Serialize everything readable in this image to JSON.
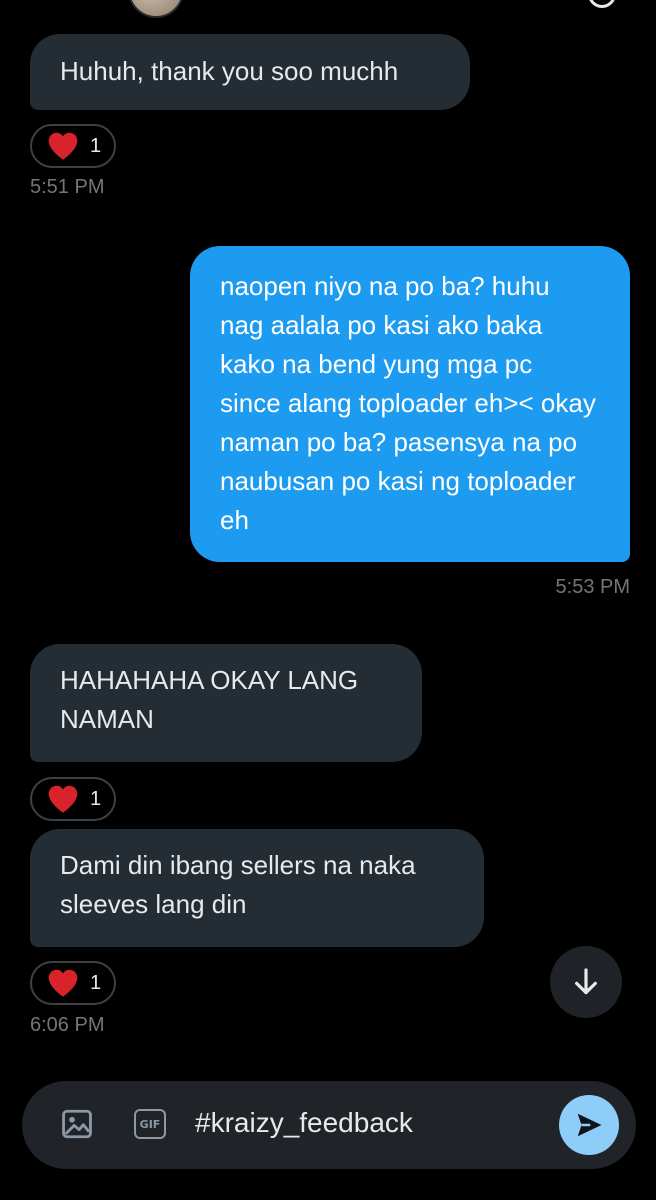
{
  "conversation": {
    "messages": [
      {
        "direction": "received",
        "text": "Huhuh, thank you soo muchh"
      },
      {
        "direction": "sent",
        "text": "naopen niyo na po ba? huhu nag aalala po kasi ako baka kako na bend yung mga pc since alang toploader eh>< okay naman po ba? pasensya na po naubusan po kasi ng toploader eh"
      },
      {
        "direction": "received",
        "text": "HAHAHAHA OKAY LANG NAMAN"
      },
      {
        "direction": "received",
        "text": "Dami din ibang sellers na naka sleeves lang din"
      }
    ],
    "reactions": [
      {
        "emoji": "heart",
        "count": "1"
      },
      {
        "emoji": "heart",
        "count": "1"
      },
      {
        "emoji": "heart",
        "count": "1"
      }
    ],
    "timestamps": [
      "5:51 PM",
      "5:53 PM",
      "6:06 PM"
    ]
  },
  "composer": {
    "value": "#kraizy_feedback",
    "gif_label": "GIF",
    "image_icon": "image-icon",
    "send_icon": "send-icon"
  },
  "scroll_button": {
    "icon": "arrow-down-icon"
  },
  "colors": {
    "background": "#000000",
    "received_bubble": "#242d34",
    "sent_bubble": "#1d9bf0",
    "heart": "#f91880",
    "accent": "#8ecdf8",
    "timestamp": "#71767b"
  }
}
